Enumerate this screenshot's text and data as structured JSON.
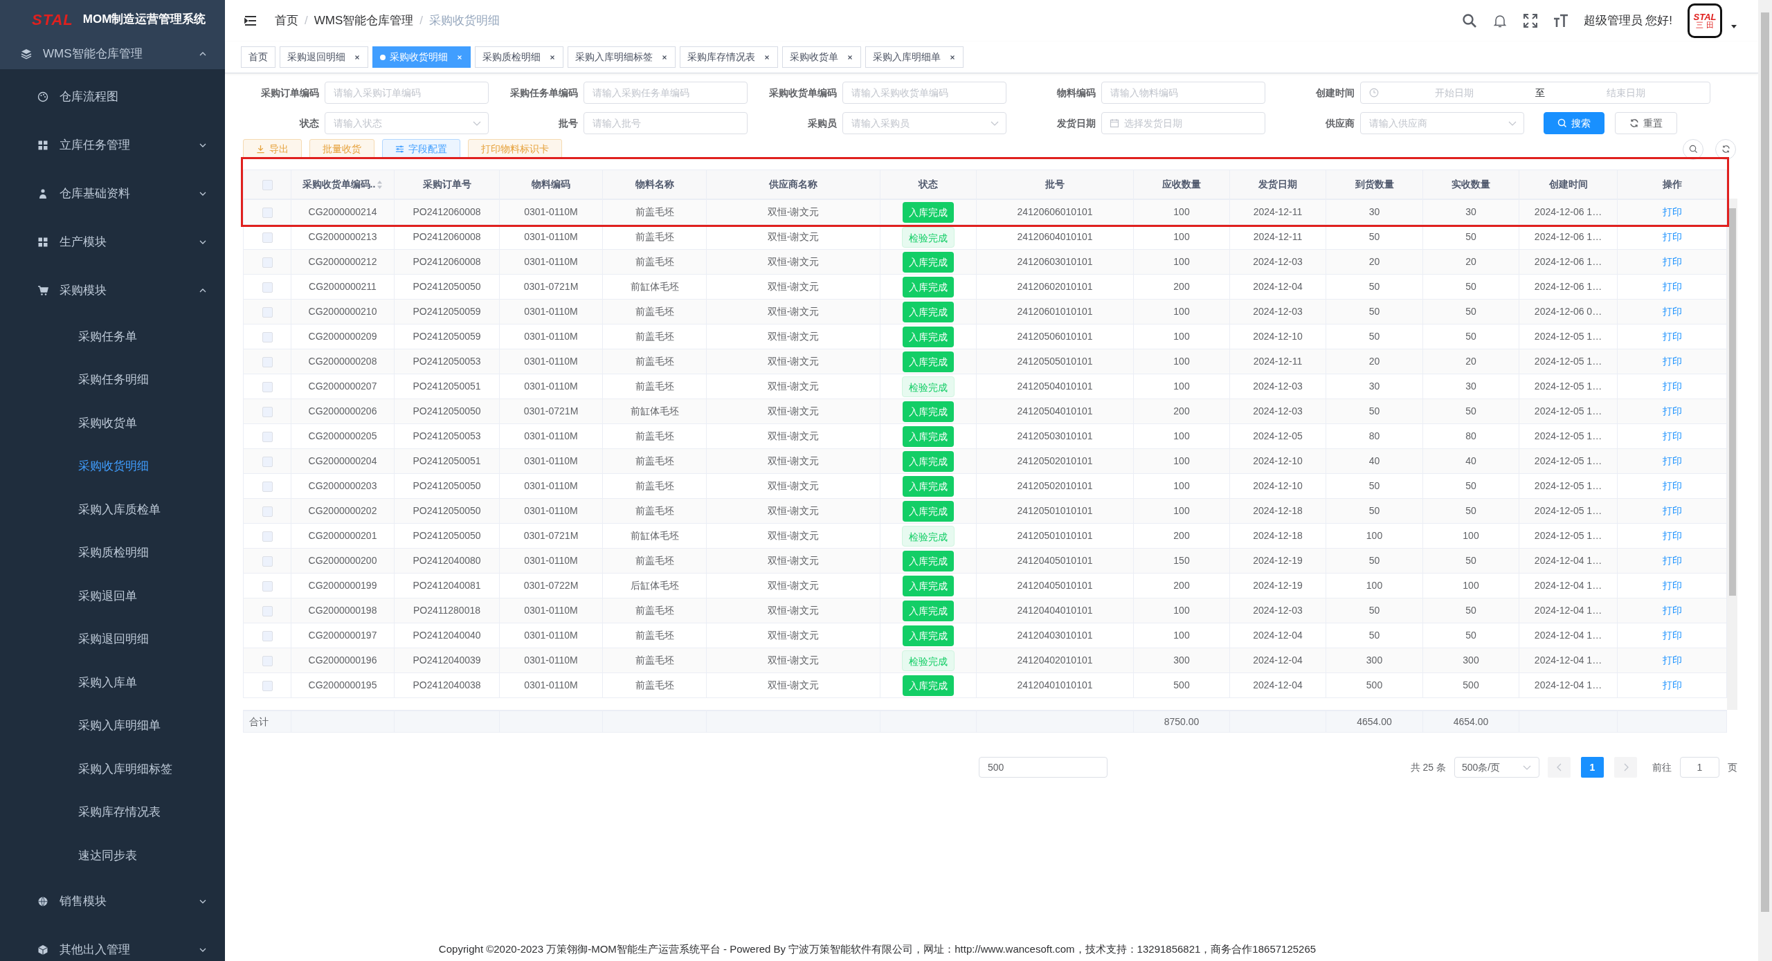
{
  "sidebar": {
    "logo": "STAL",
    "title": "MOM制造运营管理系统",
    "menu": [
      {
        "label": "WMS智能仓库管理",
        "expanded": true,
        "children": [
          {
            "label": "仓库流程图",
            "selected": false
          },
          {
            "label": "立库任务管理",
            "expanded": false
          },
          {
            "label": "仓库基础资料",
            "expanded": false
          },
          {
            "label": "生产模块",
            "expanded": false
          },
          {
            "label": "采购模块",
            "expanded": true,
            "children": [
              {
                "label": "采购任务单",
                "selected": false
              },
              {
                "label": "采购任务明细",
                "selected": false
              },
              {
                "label": "采购收货单",
                "selected": false
              },
              {
                "label": "采购收货明细",
                "selected": true
              },
              {
                "label": "采购入库质检单",
                "selected": false
              },
              {
                "label": "采购质检明细",
                "selected": false
              },
              {
                "label": "采购退回单",
                "selected": false
              },
              {
                "label": "采购退回明细",
                "selected": false
              },
              {
                "label": "采购入库单",
                "selected": false
              },
              {
                "label": "采购入库明细单",
                "selected": false
              },
              {
                "label": "采购入库明细标签",
                "selected": false
              },
              {
                "label": "采购库存情况表",
                "selected": false
              },
              {
                "label": "速达同步表",
                "selected": false
              }
            ]
          },
          {
            "label": "销售模块",
            "expanded": false
          },
          {
            "label": "其他出入管理",
            "expanded": false
          }
        ]
      }
    ]
  },
  "header": {
    "breadcrumb": [
      "首页",
      "WMS智能仓库管理",
      "采购收货明细"
    ],
    "breadcrumb_separator": "/",
    "greeting": "超级管理员 您好!",
    "avatar": {
      "logo": "STAL",
      "subtitle": "三 田"
    }
  },
  "tabs": [
    {
      "label": "首页",
      "closable": false,
      "selected": false
    },
    {
      "label": "采购退回明细",
      "closable": true,
      "selected": false
    },
    {
      "label": "采购收货明细",
      "closable": true,
      "selected": true
    },
    {
      "label": "采购质检明细",
      "closable": true,
      "selected": false
    },
    {
      "label": "采购入库明细标签",
      "closable": true,
      "selected": false
    },
    {
      "label": "采购库存情况表",
      "closable": true,
      "selected": false
    },
    {
      "label": "采购收货单",
      "closable": true,
      "selected": false
    },
    {
      "label": "采购入库明细单",
      "closable": true,
      "selected": false
    }
  ],
  "filters": [
    {
      "label": "采购订单编码",
      "kind": "text",
      "placeholder": "请输入采购订单编码"
    },
    {
      "label": "采购任务单编码",
      "kind": "text",
      "placeholder": "请输入采购任务单编码"
    },
    {
      "label": "采购收货单编码",
      "kind": "text",
      "placeholder": "请输入采购收货单编码"
    },
    {
      "label": "物料编码",
      "kind": "text",
      "placeholder": "请输入物料编码"
    },
    {
      "label": "创建时间",
      "kind": "range",
      "start_placeholder": "开始日期",
      "separator": "至",
      "end_placeholder": "结束日期"
    },
    {
      "label": "状态",
      "kind": "select",
      "placeholder": "请输入状态"
    },
    {
      "label": "批号",
      "kind": "text",
      "placeholder": "请输入批号"
    },
    {
      "label": "采购员",
      "kind": "select",
      "placeholder": "请输入采购员"
    },
    {
      "label": "发货日期",
      "kind": "date",
      "placeholder": "选择发货日期"
    },
    {
      "label": "供应商",
      "kind": "select",
      "placeholder": "请输入供应商"
    }
  ],
  "search_button": "搜索",
  "reset_button": "重置",
  "toolbar": [
    {
      "label": "导出",
      "kind": "export"
    },
    {
      "label": "批量收货",
      "kind": "plain"
    },
    {
      "label": "字段配置",
      "kind": "config"
    },
    {
      "label": "打印物料标识卡",
      "kind": "plain"
    }
  ],
  "table": {
    "highlight": true,
    "select_all_checked": false,
    "columns": [
      "采购收货单编码..",
      "采购订单号",
      "物料编码",
      "物料名称",
      "供应商名称",
      "状态",
      "批号",
      "应收数量",
      "发货日期",
      "到货数量",
      "实收数量",
      "创建时间",
      "操作"
    ],
    "rows": [
      {
        "checked": false,
        "kind": "stored",
        "cells": [
          "CG2000000214",
          "PO2412060008",
          "0301-0110M",
          "前盖毛坯",
          "双恒-谢文元",
          "入库完成",
          "24120606010101",
          "100",
          "2024-12-11",
          "30",
          "30",
          "2024-12-06 1…",
          "打印"
        ]
      },
      {
        "checked": false,
        "kind": "inspected",
        "cells": [
          "CG2000000213",
          "PO2412060008",
          "0301-0110M",
          "前盖毛坯",
          "双恒-谢文元",
          "检验完成",
          "24120604010101",
          "100",
          "2024-12-11",
          "50",
          "50",
          "2024-12-06 1…",
          "打印"
        ]
      },
      {
        "checked": false,
        "kind": "stored",
        "cells": [
          "CG2000000212",
          "PO2412060008",
          "0301-0110M",
          "前盖毛坯",
          "双恒-谢文元",
          "入库完成",
          "24120603010101",
          "100",
          "2024-12-03",
          "20",
          "20",
          "2024-12-06 1…",
          "打印"
        ]
      },
      {
        "checked": false,
        "kind": "stored",
        "cells": [
          "CG2000000211",
          "PO2412050050",
          "0301-0721M",
          "前缸体毛坯",
          "双恒-谢文元",
          "入库完成",
          "24120602010101",
          "200",
          "2024-12-04",
          "50",
          "50",
          "2024-12-06 1…",
          "打印"
        ]
      },
      {
        "checked": false,
        "kind": "stored",
        "cells": [
          "CG2000000210",
          "PO2412050059",
          "0301-0110M",
          "前盖毛坯",
          "双恒-谢文元",
          "入库完成",
          "24120601010101",
          "100",
          "2024-12-03",
          "50",
          "50",
          "2024-12-06 0…",
          "打印"
        ]
      },
      {
        "checked": false,
        "kind": "stored",
        "cells": [
          "CG2000000209",
          "PO2412050059",
          "0301-0110M",
          "前盖毛坯",
          "双恒-谢文元",
          "入库完成",
          "24120506010101",
          "100",
          "2024-12-10",
          "50",
          "50",
          "2024-12-05 1…",
          "打印"
        ]
      },
      {
        "checked": false,
        "kind": "stored",
        "cells": [
          "CG2000000208",
          "PO2412050053",
          "0301-0110M",
          "前盖毛坯",
          "双恒-谢文元",
          "入库完成",
          "24120505010101",
          "100",
          "2024-12-11",
          "20",
          "20",
          "2024-12-05 1…",
          "打印"
        ]
      },
      {
        "checked": false,
        "kind": "inspected",
        "cells": [
          "CG2000000207",
          "PO2412050051",
          "0301-0110M",
          "前盖毛坯",
          "双恒-谢文元",
          "检验完成",
          "24120504010101",
          "100",
          "2024-12-03",
          "30",
          "30",
          "2024-12-05 1…",
          "打印"
        ]
      },
      {
        "checked": false,
        "kind": "stored",
        "cells": [
          "CG2000000206",
          "PO2412050050",
          "0301-0721M",
          "前缸体毛坯",
          "双恒-谢文元",
          "入库完成",
          "24120504010101",
          "200",
          "2024-12-03",
          "50",
          "50",
          "2024-12-05 1…",
          "打印"
        ]
      },
      {
        "checked": false,
        "kind": "stored",
        "cells": [
          "CG2000000205",
          "PO2412050053",
          "0301-0110M",
          "前盖毛坯",
          "双恒-谢文元",
          "入库完成",
          "24120503010101",
          "100",
          "2024-12-05",
          "80",
          "80",
          "2024-12-05 1…",
          "打印"
        ]
      },
      {
        "checked": false,
        "kind": "stored",
        "cells": [
          "CG2000000204",
          "PO2412050051",
          "0301-0110M",
          "前盖毛坯",
          "双恒-谢文元",
          "入库完成",
          "24120502010101",
          "100",
          "2024-12-10",
          "40",
          "40",
          "2024-12-05 1…",
          "打印"
        ]
      },
      {
        "checked": false,
        "kind": "stored",
        "cells": [
          "CG2000000203",
          "PO2412050050",
          "0301-0110M",
          "前盖毛坯",
          "双恒-谢文元",
          "入库完成",
          "24120502010101",
          "100",
          "2024-12-10",
          "50",
          "50",
          "2024-12-05 1…",
          "打印"
        ]
      },
      {
        "checked": false,
        "kind": "stored",
        "cells": [
          "CG2000000202",
          "PO2412050050",
          "0301-0110M",
          "前盖毛坯",
          "双恒-谢文元",
          "入库完成",
          "24120501010101",
          "100",
          "2024-12-18",
          "50",
          "50",
          "2024-12-05 1…",
          "打印"
        ]
      },
      {
        "checked": false,
        "kind": "inspected",
        "cells": [
          "CG2000000201",
          "PO2412050050",
          "0301-0721M",
          "前缸体毛坯",
          "双恒-谢文元",
          "检验完成",
          "24120501010101",
          "200",
          "2024-12-18",
          "100",
          "100",
          "2024-12-05 1…",
          "打印"
        ]
      },
      {
        "checked": false,
        "kind": "stored",
        "cells": [
          "CG2000000200",
          "PO2412040080",
          "0301-0110M",
          "前盖毛坯",
          "双恒-谢文元",
          "入库完成",
          "24120405010101",
          "150",
          "2024-12-19",
          "50",
          "50",
          "2024-12-04 1…",
          "打印"
        ]
      },
      {
        "checked": false,
        "kind": "stored",
        "cells": [
          "CG2000000199",
          "PO2412040081",
          "0301-0722M",
          "后缸体毛坯",
          "双恒-谢文元",
          "入库完成",
          "24120405010101",
          "200",
          "2024-12-19",
          "100",
          "100",
          "2024-12-04 1…",
          "打印"
        ]
      },
      {
        "checked": false,
        "kind": "stored",
        "cells": [
          "CG2000000198",
          "PO2411280018",
          "0301-0110M",
          "前盖毛坯",
          "双恒-谢文元",
          "入库完成",
          "24120404010101",
          "100",
          "2024-12-03",
          "50",
          "50",
          "2024-12-04 1…",
          "打印"
        ]
      },
      {
        "checked": false,
        "kind": "stored",
        "cells": [
          "CG2000000197",
          "PO2412040040",
          "0301-0110M",
          "前盖毛坯",
          "双恒-谢文元",
          "入库完成",
          "24120403010101",
          "100",
          "2024-12-04",
          "50",
          "50",
          "2024-12-04 1…",
          "打印"
        ]
      },
      {
        "checked": false,
        "kind": "inspected",
        "cells": [
          "CG2000000196",
          "PO2412040039",
          "0301-0110M",
          "前盖毛坯",
          "双恒-谢文元",
          "检验完成",
          "24120402010101",
          "300",
          "2024-12-04",
          "300",
          "300",
          "2024-12-04 1…",
          "打印"
        ]
      },
      {
        "checked": false,
        "kind": "stored",
        "cells": [
          "CG2000000195",
          "PO2412040038",
          "0301-0110M",
          "前盖毛坯",
          "双恒-谢文元",
          "入库完成",
          "24120401010101",
          "500",
          "2024-12-04",
          "500",
          "500",
          "2024-12-04 1…",
          "打印"
        ]
      }
    ],
    "totals": {
      "label": "合计",
      "expected_qty": "8750.00",
      "arrived_qty": "4654.00",
      "received_qty": "4654.00"
    }
  },
  "pagination": {
    "size_input": "500",
    "total": "共 25 条",
    "page_size": "500条/页",
    "pages": [
      {
        "label": "1",
        "selected": true
      }
    ],
    "goto_label": "前往",
    "goto_value": "1",
    "goto_suffix": "页"
  },
  "footer": "Copyright ©2020-2023 万策翎御-MOM智能生产运营系统平台 - Powered By 宁波万策智能软件有限公司，网址：http://www.wancesoft.com，技术支持：13291856821，商务合作18657125265"
}
